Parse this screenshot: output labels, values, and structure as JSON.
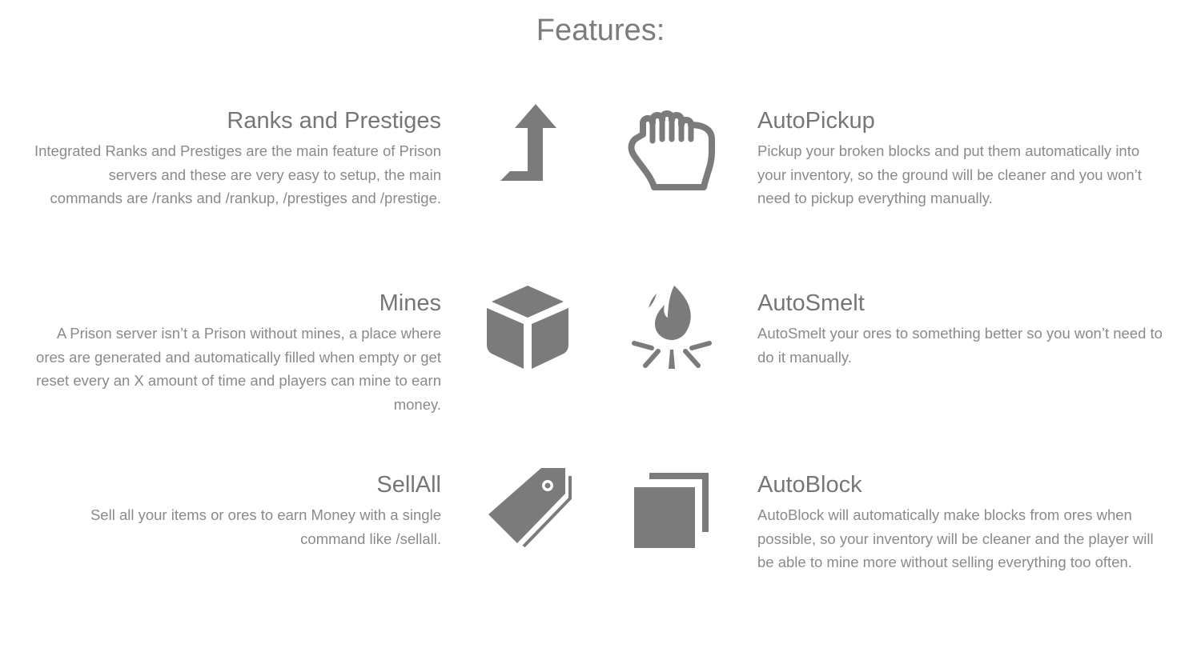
{
  "page": {
    "title": "Features:"
  },
  "features": {
    "ranks": {
      "title": "Ranks and Prestiges",
      "description": "Integrated Ranks and Prestiges are the main feature of Prison servers and these are very easy to setup, the main commands are /ranks and /rankup, /prestiges and /prestige.",
      "icon": "level-up-arrow-icon"
    },
    "autopickup": {
      "title": "AutoPickup",
      "description": "Pickup your broken blocks and put them automatically into your inventory, so the ground will be cleaner and you won’t need to pickup everything manually.",
      "icon": "grab-hand-icon"
    },
    "mines": {
      "title": "Mines",
      "description": "A Prison server isn’t a Prison without mines, a place where ores are generated and automatically filled when empty or get reset every an X amount of time and players can mine to earn money.",
      "icon": "cube-icon"
    },
    "autosmelt": {
      "title": "AutoSmelt",
      "description": "AutoSmelt your ores to something better so you won’t need to do it manually.",
      "icon": "campfire-icon"
    },
    "sellall": {
      "title": "SellAll",
      "description": "Sell all your items or ores to earn Money with a single command like /sellall.",
      "icon": "price-tag-icon"
    },
    "autoblock": {
      "title": "AutoBlock",
      "description": "AutoBlock will automatically make blocks from ores when possible, so your inventory will be cleaner and the player will be able to mine more without selling everything too often.",
      "icon": "clone-squares-icon"
    }
  },
  "colors": {
    "icon": "#7b7b7b",
    "title": "#767676",
    "text": "#8a8a8a",
    "background": "#ffffff"
  }
}
